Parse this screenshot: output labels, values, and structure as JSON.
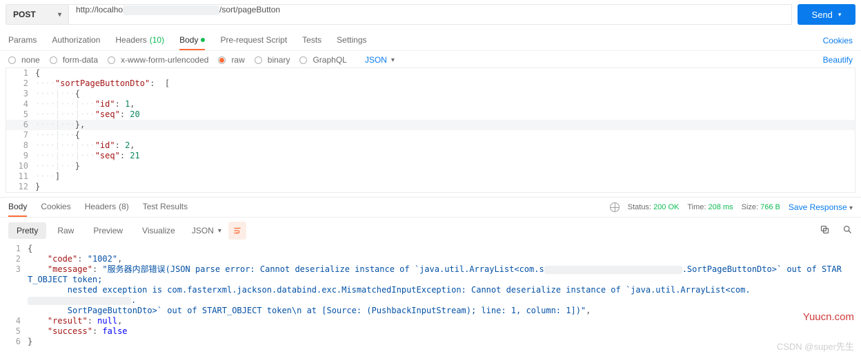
{
  "request": {
    "method": "POST",
    "url_prefix": "http://localho",
    "url_suffix": "/sort/pageButton",
    "send_label": "Send"
  },
  "tabs": {
    "params": "Params",
    "authorization": "Authorization",
    "headers": "Headers",
    "headers_count": "(10)",
    "body": "Body",
    "prerequest": "Pre-request Script",
    "tests": "Tests",
    "settings": "Settings",
    "cookies": "Cookies"
  },
  "body_opts": {
    "none": "none",
    "formdata": "form-data",
    "xwww": "x-www-form-urlencoded",
    "raw": "raw",
    "binary": "binary",
    "graphql": "GraphQL",
    "format": "JSON",
    "beautify": "Beautify"
  },
  "req_code": {
    "l1": "{",
    "l2_key": "\"sortPageButtonDto\"",
    "l3": "{",
    "l4_key": "\"id\"",
    "l4_val": "1",
    "l5_key": "\"seq\"",
    "l5_val": "20",
    "l6": "},",
    "l7": "{",
    "l8_key": "\"id\"",
    "l8_val": "2",
    "l9_key": "\"seq\"",
    "l9_val": "21",
    "l10": "}",
    "l11": "]",
    "l12": "}"
  },
  "resp_tabs": {
    "body": "Body",
    "cookies": "Cookies",
    "headers": "Headers",
    "headers_count": "(8)",
    "tests": "Test Results"
  },
  "status": {
    "label_status": "Status:",
    "status": "200 OK",
    "label_time": "Time:",
    "time": "208 ms",
    "label_size": "Size:",
    "size": "766 B",
    "save": "Save Response"
  },
  "fmt": {
    "pretty": "Pretty",
    "raw": "Raw",
    "preview": "Preview",
    "visualize": "Visualize",
    "json": "JSON"
  },
  "resp_code": {
    "l1": "{",
    "l2_key": "\"code\"",
    "l2_val": "\"1002\"",
    "l3_key": "\"message\"",
    "l3_a": "\"服务器内部错误(JSON parse error: Cannot deserialize instance of `java.util.ArrayList<com.s",
    "l3_b": ".SortPageButtonDto>` out of START_OBJECT token;",
    "l3_c": "nested exception is com.fasterxml.jackson.databind.exc.MismatchedInputException: Cannot deserialize instance of `java.util.ArrayList<com.",
    "l3_d": "SortPageButtonDto>` out of START_OBJECT token\\n at [Source: (PushbackInputStream); line: 1, column: 1])\"",
    "l4_key": "\"result\"",
    "l4_val": "null",
    "l5_key": "\"success\"",
    "l5_val": "false",
    "l6": "}"
  },
  "marks": {
    "csdn": "CSDN @super先生",
    "yuu": "Yuucn.com"
  }
}
